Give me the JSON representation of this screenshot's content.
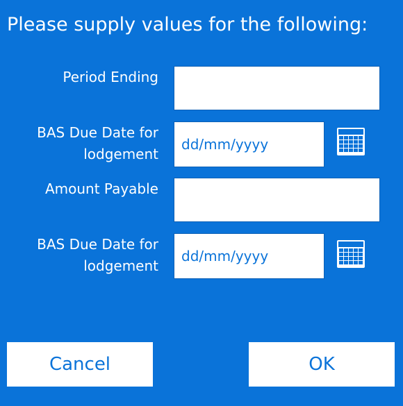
{
  "dialog": {
    "title": "Please supply values for the following:"
  },
  "fields": {
    "period_ending": {
      "label": "Period Ending",
      "value": "",
      "placeholder": ""
    },
    "bas_due_date_1": {
      "label_line1": "BAS Due Date for",
      "label_line2": "lodgement",
      "value": "",
      "placeholder": "dd/mm/yyyy",
      "icon": "calendar-icon"
    },
    "amount_payable": {
      "label": "Amount Payable",
      "value": "",
      "placeholder": ""
    },
    "bas_due_date_2": {
      "label_line1": "BAS Due Date for",
      "label_line2": "lodgement",
      "value": "",
      "placeholder": "dd/mm/yyyy",
      "icon": "calendar-icon"
    }
  },
  "buttons": {
    "cancel_label": "Cancel",
    "ok_label": "OK"
  },
  "colors": {
    "background": "#0a73d9",
    "text": "#ffffff",
    "accent": "#0a73d9"
  }
}
